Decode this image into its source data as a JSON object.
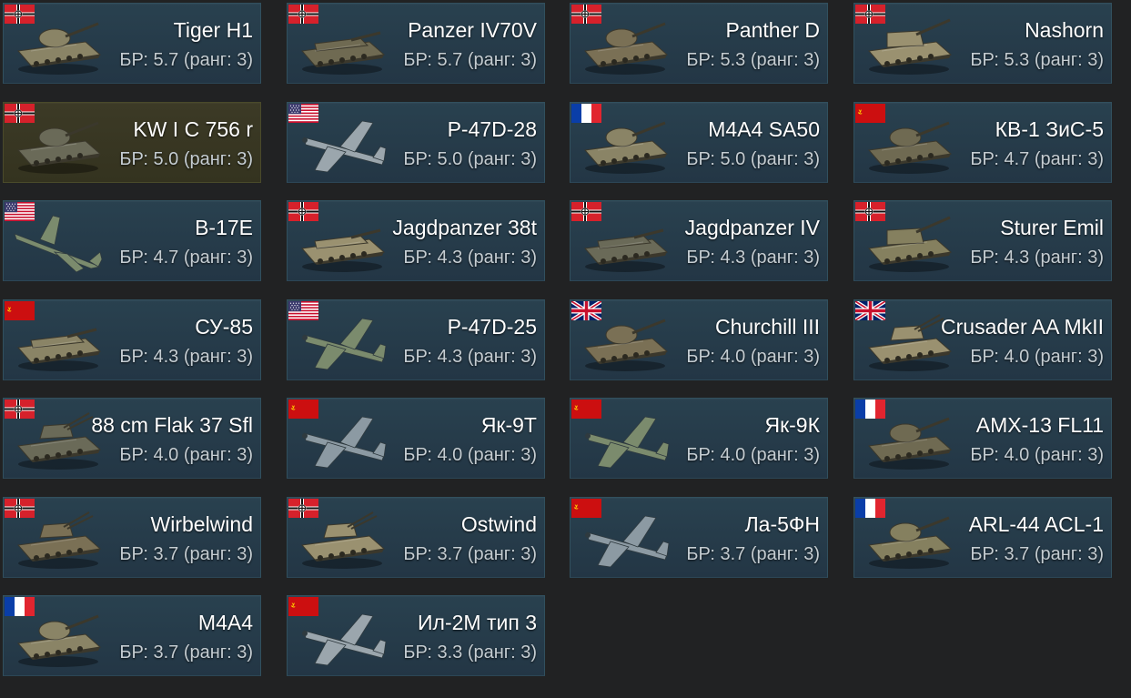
{
  "vehicles": [
    {
      "name": "Tiger H1",
      "br_text": "БР: 5.7 (ранг: 3)",
      "nation": "germany",
      "kind": "tank",
      "icon": "tank-icon"
    },
    {
      "name": "Panzer IV70V",
      "br_text": "БР: 5.7 (ранг: 3)",
      "nation": "germany",
      "kind": "td",
      "icon": "tank-destroyer-icon"
    },
    {
      "name": "Panther D",
      "br_text": "БР: 5.3 (ранг: 3)",
      "nation": "germany",
      "kind": "tank",
      "icon": "tank-icon"
    },
    {
      "name": "Nashorn",
      "br_text": "БР: 5.3 (ранг: 3)",
      "nation": "germany",
      "kind": "spg",
      "icon": "self-propelled-gun-icon"
    },
    {
      "name": "KW I C 756 r",
      "br_text": "БР: 5.0 (ранг: 3)",
      "nation": "germany",
      "kind": "tank",
      "icon": "tank-icon",
      "highlight": true
    },
    {
      "name": "P-47D-28",
      "br_text": "БР: 5.0 (ранг: 3)",
      "nation": "usa",
      "kind": "plane",
      "icon": "fighter-plane-icon"
    },
    {
      "name": "M4A4 SA50",
      "br_text": "БР: 5.0 (ранг: 3)",
      "nation": "france",
      "kind": "tank",
      "icon": "tank-icon"
    },
    {
      "name": "КВ-1 ЗиС-5",
      "br_text": "БР: 4.7 (ранг: 3)",
      "nation": "ussr",
      "kind": "tank",
      "icon": "tank-icon"
    },
    {
      "name": "B-17E",
      "br_text": "БР: 4.7 (ранг: 3)",
      "nation": "usa",
      "kind": "bomber",
      "icon": "bomber-plane-icon"
    },
    {
      "name": "Jagdpanzer 38t",
      "br_text": "БР: 4.3 (ранг: 3)",
      "nation": "germany",
      "kind": "td",
      "icon": "tank-destroyer-icon"
    },
    {
      "name": "Jagdpanzer IV",
      "br_text": "БР: 4.3 (ранг: 3)",
      "nation": "germany",
      "kind": "td",
      "icon": "tank-destroyer-icon"
    },
    {
      "name": "Sturer Emil",
      "br_text": "БР: 4.3 (ранг: 3)",
      "nation": "germany",
      "kind": "spg",
      "icon": "self-propelled-gun-icon"
    },
    {
      "name": "СУ-85",
      "br_text": "БР: 4.3 (ранг: 3)",
      "nation": "ussr",
      "kind": "td",
      "icon": "tank-destroyer-icon"
    },
    {
      "name": "P-47D-25",
      "br_text": "БР: 4.3 (ранг: 3)",
      "nation": "usa",
      "kind": "plane",
      "icon": "fighter-plane-icon"
    },
    {
      "name": "Churchill III",
      "br_text": "БР: 4.0 (ранг: 3)",
      "nation": "uk",
      "kind": "tank",
      "icon": "tank-icon"
    },
    {
      "name": "Crusader AA MkII",
      "br_text": "БР: 4.0 (ранг: 3)",
      "nation": "uk",
      "kind": "spaa",
      "icon": "anti-aircraft-vehicle-icon"
    },
    {
      "name": "88 cm Flak 37 Sfl",
      "br_text": "БР: 4.0 (ранг: 3)",
      "nation": "germany",
      "kind": "spaa",
      "icon": "anti-aircraft-vehicle-icon"
    },
    {
      "name": "Як-9Т",
      "br_text": "БР: 4.0 (ранг: 3)",
      "nation": "ussr",
      "kind": "plane",
      "icon": "fighter-plane-icon"
    },
    {
      "name": "Як-9К",
      "br_text": "БР: 4.0 (ранг: 3)",
      "nation": "ussr",
      "kind": "plane",
      "icon": "fighter-plane-icon"
    },
    {
      "name": "AMX-13 FL11",
      "br_text": "БР: 4.0 (ранг: 3)",
      "nation": "france",
      "kind": "tank",
      "icon": "tank-icon"
    },
    {
      "name": "Wirbelwind",
      "br_text": "БР: 3.7 (ранг: 3)",
      "nation": "germany",
      "kind": "spaa",
      "icon": "anti-aircraft-vehicle-icon"
    },
    {
      "name": "Ostwind",
      "br_text": "БР: 3.7 (ранг: 3)",
      "nation": "germany",
      "kind": "spaa",
      "icon": "anti-aircraft-vehicle-icon"
    },
    {
      "name": "Ла-5ФН",
      "br_text": "БР: 3.7 (ранг: 3)",
      "nation": "ussr",
      "kind": "plane",
      "icon": "fighter-plane-icon"
    },
    {
      "name": "ARL-44 ACL-1",
      "br_text": "БР: 3.7 (ранг: 3)",
      "nation": "france",
      "kind": "tank",
      "icon": "tank-icon"
    },
    {
      "name": "M4A4",
      "br_text": "БР: 3.7 (ранг: 3)",
      "nation": "france",
      "kind": "tank",
      "icon": "tank-icon"
    },
    {
      "name": "Ил-2М тип 3",
      "br_text": "БР: 3.3 (ранг: 3)",
      "nation": "ussr",
      "kind": "plane",
      "icon": "attacker-plane-icon"
    }
  ],
  "colors": {
    "card_bg": "#263c4a",
    "card_border": "#31505e",
    "highlight_bg": "#38361f",
    "page_bg": "#212223",
    "name_text": "#ffffff",
    "br_text": "#c5cdd2"
  }
}
